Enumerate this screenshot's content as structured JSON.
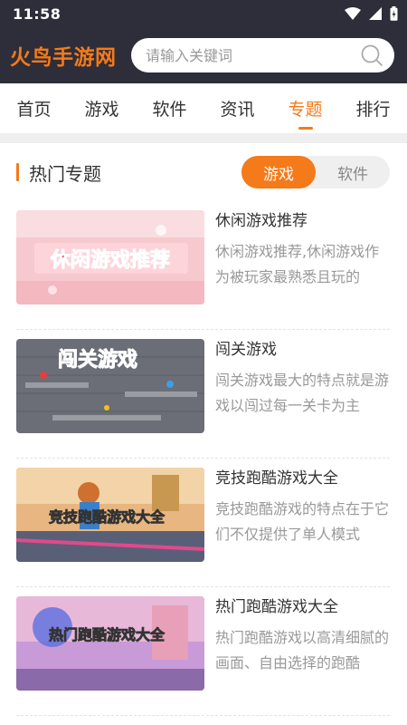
{
  "status_bar": {
    "time": "11:58"
  },
  "header": {
    "logo": "火鸟手游网",
    "search_placeholder": "请输入关键词"
  },
  "nav": {
    "tabs": [
      {
        "label": "首页"
      },
      {
        "label": "游戏"
      },
      {
        "label": "软件"
      },
      {
        "label": "资讯"
      },
      {
        "label": "专题",
        "active": true
      },
      {
        "label": "排行"
      }
    ]
  },
  "section": {
    "title": "热门专题",
    "toggle": [
      {
        "label": "游戏",
        "active": true
      },
      {
        "label": "软件"
      }
    ]
  },
  "topics": [
    {
      "title": "休闲游戏推荐",
      "desc": "休闲游戏推荐,休闲游戏作为被玩家最熟悉且玩的",
      "image_text": "休闲游戏推荐"
    },
    {
      "title": "闯关游戏",
      "desc": "闯关游戏最大的特点就是游戏以闯过每一关卡为主",
      "image_text": "闯关游戏"
    },
    {
      "title": "竞技跑酷游戏大全",
      "desc": "竞技跑酷游戏的特点在于它们不仅提供了单人模式",
      "image_text": "竞技跑酷游戏大全"
    },
    {
      "title": "热门跑酷游戏大全",
      "desc": "热门跑酷游戏以高清细腻的画面、自由选择的跑酷",
      "image_text": "热门跑酷游戏大全"
    }
  ],
  "colors": {
    "accent": "#f47a1a",
    "header_bg": "#2d2e3a"
  }
}
